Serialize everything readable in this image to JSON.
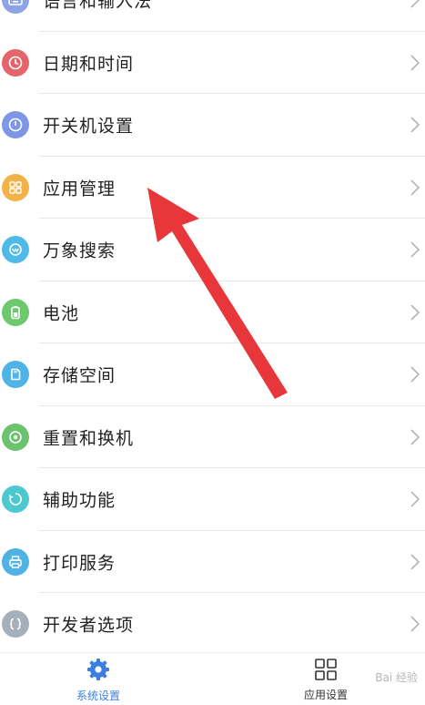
{
  "settings_items": [
    {
      "label": "语言和输入法",
      "icon": "keyboard-icon",
      "color": "#8fa3e8"
    },
    {
      "label": "日期和时间",
      "icon": "clock-icon",
      "color": "#e2666c"
    },
    {
      "label": "开关机设置",
      "icon": "power-icon",
      "color": "#7f96e6"
    },
    {
      "label": "应用管理",
      "icon": "apps-grid-icon",
      "color": "#f3b246"
    },
    {
      "label": "万象搜索",
      "icon": "search-icon",
      "color": "#4fb9e8"
    },
    {
      "label": "电池",
      "icon": "battery-icon",
      "color": "#6dc86e"
    },
    {
      "label": "存储空间",
      "icon": "storage-icon",
      "color": "#4fb3e6"
    },
    {
      "label": "重置和换机",
      "icon": "reset-icon",
      "color": "#6bc46d"
    },
    {
      "label": "辅助功能",
      "icon": "accessibility-icon",
      "color": "#4cc8cf"
    },
    {
      "label": "打印服务",
      "icon": "printer-icon",
      "color": "#4fb1e4"
    },
    {
      "label": "开发者选项",
      "icon": "code-braces-icon",
      "color": "#a6b0bb"
    }
  ],
  "bottom_nav": {
    "system_settings": {
      "label": "系统设置",
      "icon": "gear-icon",
      "color": "#3d7fe0",
      "active": true
    },
    "app_settings": {
      "label": "应用设置",
      "icon": "grid-icon",
      "color": "#333333",
      "active": false
    }
  },
  "watermark": "Bai 经验",
  "annotation": {
    "icon": "red-arrow-annotation",
    "color": "#e8373a",
    "points_to": "应用管理"
  }
}
